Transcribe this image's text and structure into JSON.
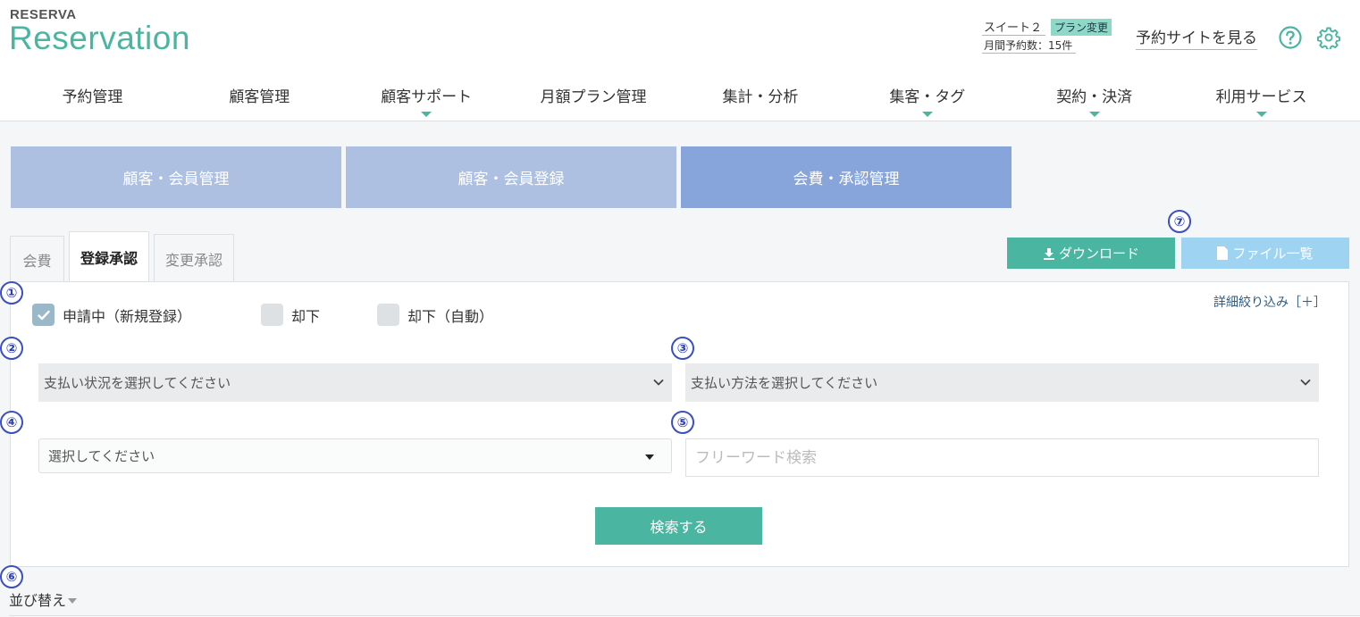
{
  "logo": {
    "small": "RESERVA",
    "big": "Reservation"
  },
  "plan": {
    "name": "スイート２",
    "change_label": "プラン変更",
    "monthly_count": "月間予約数：15件"
  },
  "header": {
    "site_link": "予約サイトを見る",
    "help_icon": "question-circle-icon",
    "settings_icon": "gear-icon"
  },
  "nav": {
    "items": [
      {
        "label": "予約管理",
        "has_dropdown": false
      },
      {
        "label": "顧客管理",
        "has_dropdown": false
      },
      {
        "label": "顧客サポート",
        "has_dropdown": true
      },
      {
        "label": "月額プラン管理",
        "has_dropdown": false
      },
      {
        "label": "集計・分析",
        "has_dropdown": false
      },
      {
        "label": "集客・タグ",
        "has_dropdown": true
      },
      {
        "label": "契約・決済",
        "has_dropdown": true
      },
      {
        "label": "利用サービス",
        "has_dropdown": true
      }
    ]
  },
  "subtabs": [
    {
      "label": "顧客・会員管理",
      "active": false
    },
    {
      "label": "顧客・会員登録",
      "active": false
    },
    {
      "label": "会費・承認管理",
      "active": true
    }
  ],
  "tabs": [
    {
      "label": "会費",
      "active": false
    },
    {
      "label": "登録承認",
      "active": true
    },
    {
      "label": "変更承認",
      "active": false
    }
  ],
  "badges": [
    "①",
    "②",
    "③",
    "④",
    "⑤",
    "⑥",
    "⑦"
  ],
  "actions": {
    "download_label": "ダウンロード",
    "files_label": "ファイル一覧"
  },
  "filters": {
    "detail_link": "詳細絞り込み［＋］",
    "checkboxes": [
      {
        "label": "申請中（新規登録）",
        "checked": true
      },
      {
        "label": "却下",
        "checked": false
      },
      {
        "label": "却下（自動）",
        "checked": false
      }
    ],
    "payment_status": "支払い状況を選択してください",
    "payment_method": "支払い方法を選択してください",
    "select_generic": "選択してください",
    "free_word_placeholder": "フリーワード検索",
    "search_button": "検索する"
  },
  "sort": {
    "label": "並び替え"
  },
  "colors": {
    "accent": "#4ab5a0",
    "subtab": "#aec0e2",
    "subtab_active": "#87a5da",
    "files_button": "#9fd3f2",
    "badge": "#3a4fc0"
  }
}
